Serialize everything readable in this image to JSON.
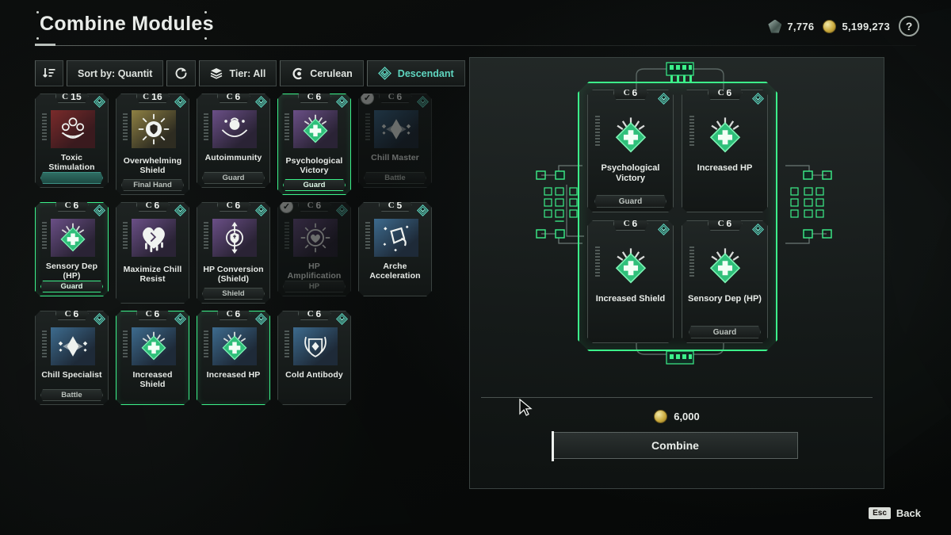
{
  "header": {
    "title": "Combine Modules",
    "currencies": [
      {
        "icon": "crystal-icon",
        "value": "7,776"
      },
      {
        "icon": "gold-coin-icon",
        "value": "5,199,273"
      }
    ],
    "help_label": "?"
  },
  "filters": [
    {
      "name": "sort-direction",
      "icon": "sort-descending-icon",
      "label": ""
    },
    {
      "name": "sort-by",
      "icon": "",
      "label": "Sort by: Quantit"
    },
    {
      "name": "reset-filters",
      "icon": "refresh-icon",
      "label": ""
    },
    {
      "name": "tier-filter",
      "icon": "layers-icon",
      "label": "Tier: All"
    },
    {
      "name": "cerulean-filter",
      "icon": "cerulean-icon",
      "label": "Cerulean"
    },
    {
      "name": "descendant-filter",
      "icon": "descendant-icon",
      "label": "Descendant"
    }
  ],
  "modules": [
    {
      "tier": "C",
      "count": "15",
      "name": "Toxic Stimulation",
      "sub": "",
      "sub_style": "teal",
      "icon": "toxic-icon",
      "icon_bg": "red",
      "selected": false,
      "checked": false,
      "dim": false
    },
    {
      "tier": "C",
      "count": "16",
      "name": "Overwhelming Shield",
      "sub": "Final Hand",
      "sub_style": "normal",
      "icon": "shield-burst-icon",
      "icon_bg": "gold",
      "selected": false,
      "checked": false,
      "dim": false
    },
    {
      "tier": "C",
      "count": "6",
      "name": "Autoimmunity",
      "sub": "Guard",
      "sub_style": "normal",
      "icon": "autoimmunity-icon",
      "icon_bg": "purple",
      "selected": false,
      "checked": false,
      "dim": false
    },
    {
      "tier": "C",
      "count": "6",
      "name": "Psychological Victory",
      "sub": "Guard",
      "sub_style": "normal",
      "icon": "green-plus-icon",
      "icon_bg": "purple",
      "selected": true,
      "checked": false,
      "dim": false
    },
    {
      "tier": "C",
      "count": "6",
      "name": "Chill Master",
      "sub": "Battle",
      "sub_style": "normal",
      "icon": "chill-diamond-icon",
      "icon_bg": "blue",
      "selected": false,
      "checked": true,
      "dim": true
    },
    {
      "tier": "C",
      "count": "6",
      "name": "Sensory Dep (HP)",
      "sub": "Guard",
      "sub_style": "normal",
      "icon": "green-plus-icon",
      "icon_bg": "purple",
      "selected": true,
      "checked": false,
      "dim": false
    },
    {
      "tier": "C",
      "count": "6",
      "name": "Maximize Chill Resist",
      "sub": "",
      "sub_style": "none",
      "icon": "melting-heart-icon",
      "icon_bg": "purple",
      "selected": false,
      "checked": false,
      "dim": false
    },
    {
      "tier": "C",
      "count": "6",
      "name": "HP Conversion (Shield)",
      "sub": "Shield",
      "sub_style": "normal",
      "icon": "shield-convert-icon",
      "icon_bg": "purple",
      "selected": false,
      "checked": false,
      "dim": false
    },
    {
      "tier": "C",
      "count": "6",
      "name": "HP Amplification",
      "sub": "HP",
      "sub_style": "normal",
      "icon": "heart-burst-icon",
      "icon_bg": "purple",
      "selected": false,
      "checked": true,
      "dim": true
    },
    {
      "tier": "C",
      "count": "5",
      "name": "Arche Acceleration",
      "sub": "",
      "sub_style": "none",
      "icon": "arche-icon",
      "icon_bg": "blue",
      "selected": false,
      "checked": false,
      "dim": false
    },
    {
      "tier": "C",
      "count": "6",
      "name": "Chill Specialist",
      "sub": "Battle",
      "sub_style": "normal",
      "icon": "chill-diamond-icon",
      "icon_bg": "blue",
      "selected": false,
      "checked": false,
      "dim": false
    },
    {
      "tier": "C",
      "count": "6",
      "name": "Increased Shield",
      "sub": "",
      "sub_style": "none",
      "icon": "green-plus-icon",
      "icon_bg": "blue",
      "selected": true,
      "checked": false,
      "dim": false
    },
    {
      "tier": "C",
      "count": "6",
      "name": "Increased HP",
      "sub": "",
      "sub_style": "none",
      "icon": "green-plus-icon",
      "icon_bg": "blue",
      "selected": true,
      "checked": false,
      "dim": false
    },
    {
      "tier": "C",
      "count": "6",
      "name": "Cold Antibody",
      "sub": "",
      "sub_style": "none",
      "icon": "cold-antibody-icon",
      "icon_bg": "blue",
      "selected": false,
      "checked": false,
      "dim": false
    }
  ],
  "combine": {
    "slots": [
      {
        "tier": "C",
        "count": "6",
        "name": "Psychological Victory",
        "sub": "Guard",
        "icon_bg": "purple"
      },
      {
        "tier": "C",
        "count": "6",
        "name": "Increased HP",
        "sub": "",
        "icon_bg": "blue"
      },
      {
        "tier": "C",
        "count": "6",
        "name": "Increased Shield",
        "sub": "",
        "icon_bg": "blue"
      },
      {
        "tier": "C",
        "count": "6",
        "name": "Sensory Dep (HP)",
        "sub": "Guard",
        "icon_bg": "purple"
      }
    ],
    "cost": "6,000",
    "cost_icon": "gold-coin-icon",
    "button_label": "Combine"
  },
  "footer": {
    "key": "Esc",
    "label": "Back"
  },
  "colors": {
    "accent_green": "#3cf08a",
    "teal": "#5fd6c0",
    "gold": "#c9a93c",
    "text": "#e8ece8"
  }
}
